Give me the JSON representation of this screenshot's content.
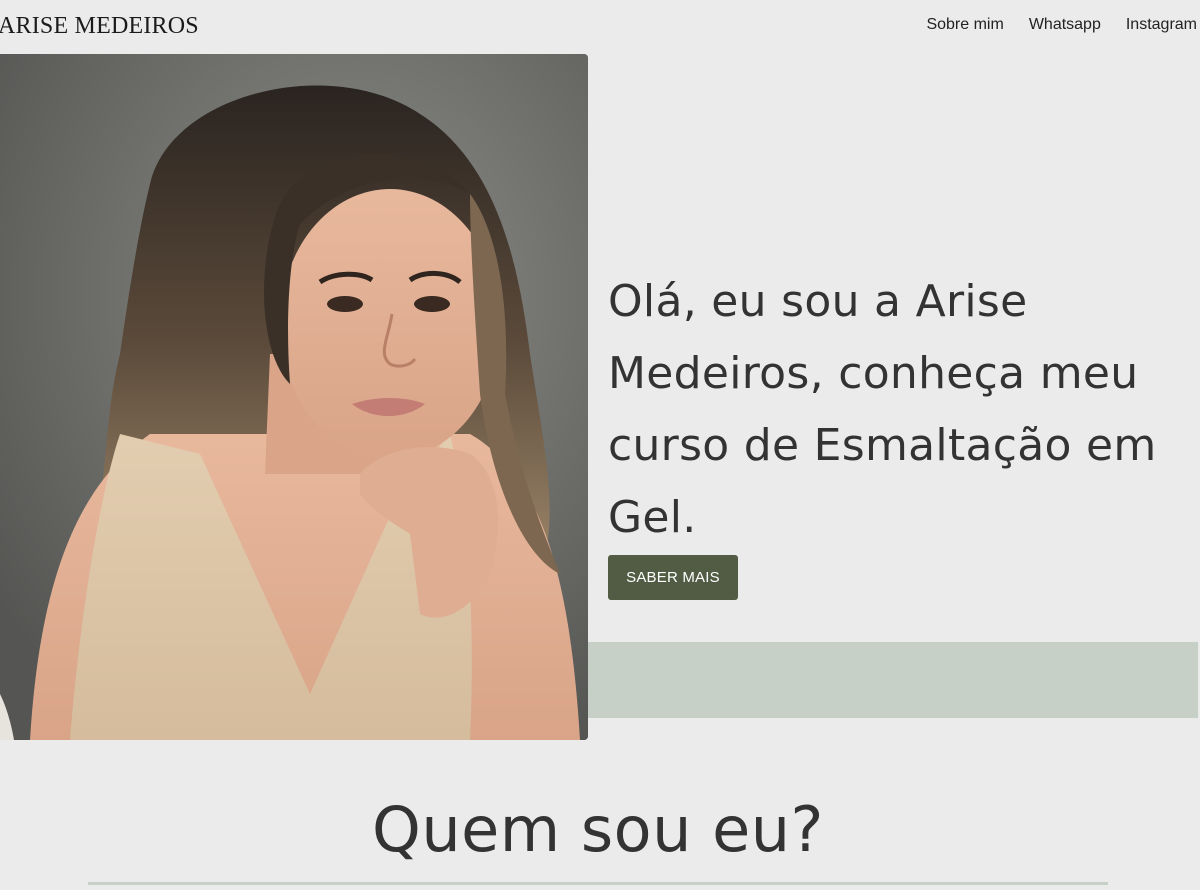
{
  "header": {
    "brand": "ARISE MEDEIROS",
    "nav": [
      {
        "label": "Sobre mim"
      },
      {
        "label": "Whatsapp"
      },
      {
        "label": "Instagram"
      }
    ]
  },
  "hero": {
    "portrait_alt": "Foto de Arise Medeiros",
    "heading": "Olá, eu sou a Arise Medeiros, conheça meu curso de Esmaltação em Gel.",
    "cta_label": "SABER MAIS"
  },
  "about": {
    "title": "Quem sou eu?"
  },
  "colors": {
    "background": "#ebebeb",
    "accent_green": "#c6d0c7",
    "button_green": "#525b43",
    "text": "#333333"
  }
}
